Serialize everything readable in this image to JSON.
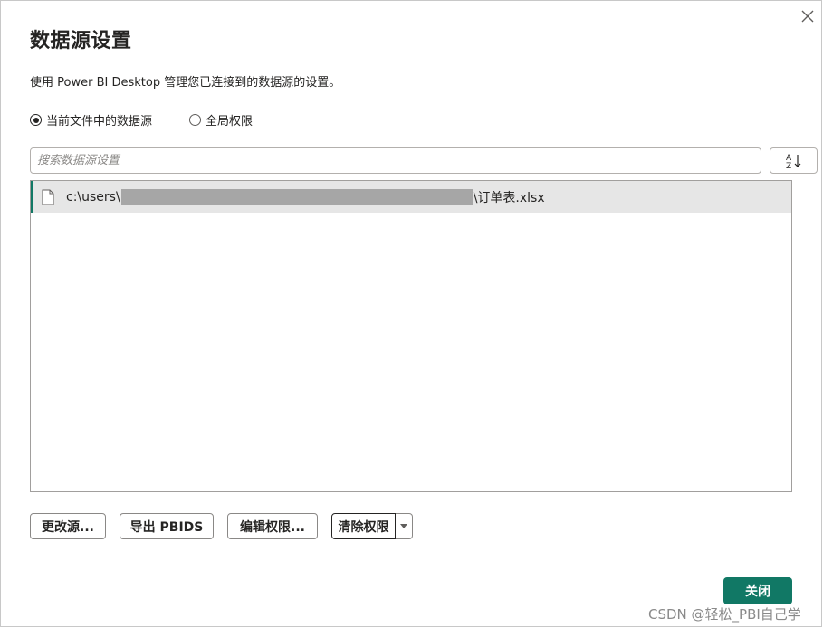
{
  "dialog": {
    "title": "数据源设置",
    "description": "使用 Power BI Desktop 管理您已连接到的数据源的设置。",
    "close_icon": "close-x-icon"
  },
  "scope": {
    "options": [
      {
        "label": "当前文件中的数据源",
        "checked": true
      },
      {
        "label": "全局权限",
        "checked": false
      }
    ]
  },
  "search": {
    "placeholder": "搜索数据源设置",
    "value": ""
  },
  "sort_button": {
    "icon": "sort-az-icon"
  },
  "list": {
    "items": [
      {
        "icon": "file-icon",
        "path_prefix": "c:\\users\\",
        "path_suffix": "\\订单表.xlsx",
        "selected": true
      }
    ]
  },
  "actions": {
    "change_source": "更改源...",
    "export_pbids": "导出 PBIDS",
    "edit_permissions": "编辑权限...",
    "clear_permissions": "清除权限",
    "clear_dropdown_icon": "caret-down-icon"
  },
  "footer": {
    "close_label": "关闭",
    "watermark": "CSDN @轻松_PBI自己学"
  },
  "colors": {
    "accent": "#117865",
    "selected_row": "#e6e6e6"
  }
}
